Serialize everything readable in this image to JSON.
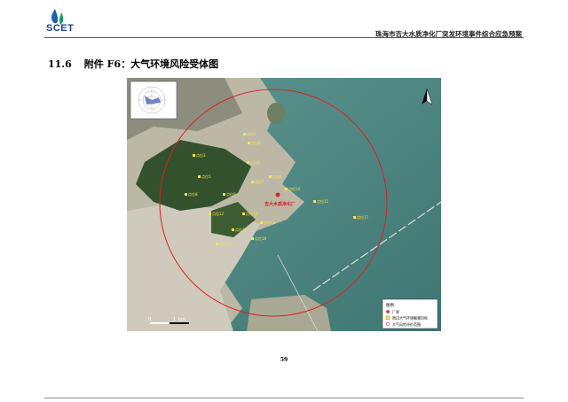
{
  "header": {
    "logo_text": "SCET",
    "document_title": "珠海市吉大水质净化厂突发环境事件综合应急预案"
  },
  "section": {
    "number": "11.6",
    "title": "附件 F6：大气环境风险受体图"
  },
  "map": {
    "facility_label": "吉大水质净化厂",
    "receptor_labels": [
      "点位1",
      "点位2",
      "点位3",
      "点位4",
      "点位5",
      "点位6",
      "点位7",
      "点位8",
      "点位9",
      "点位10",
      "点位11",
      "点位12",
      "点位13",
      "点位14",
      "点位15",
      "点位16",
      "点位17",
      "点位18"
    ],
    "scale": {
      "zero": "0",
      "one": "1",
      "unit": "km"
    },
    "legend": {
      "title": "图例",
      "items": [
        "厂界",
        "周边大气环境敏感目标",
        "大气风险评价范围"
      ]
    },
    "colors": {
      "circle": "#d9232a",
      "sea": "#4f8a87",
      "land": "#c7c2b2",
      "vegetation": "#36522e",
      "label": "#f4e64c"
    }
  },
  "page_number": "59"
}
